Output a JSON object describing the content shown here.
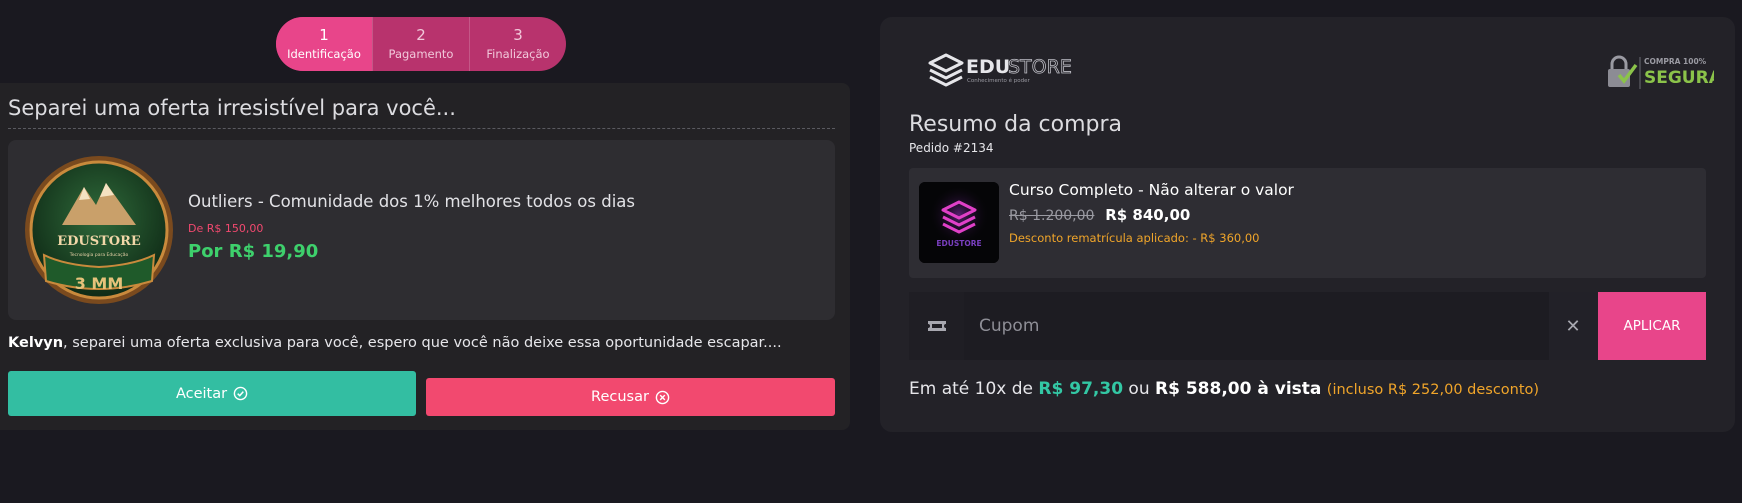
{
  "stepper": {
    "steps": [
      {
        "num": "1",
        "label": "Identificação"
      },
      {
        "num": "2",
        "label": "Pagamento"
      },
      {
        "num": "3",
        "label": "Finalização"
      }
    ],
    "active_index": 0
  },
  "offer": {
    "title": "Separei uma oferta irresistível para você...",
    "product_name": "Outliers - Comunidade dos 1% melhores todos os dias",
    "old_price": "De R$ 150,00",
    "new_price": "Por R$ 19,90",
    "badge_brand": "EDUSTORE",
    "badge_caption": "Tecnologia para Educação",
    "badge_label": "3 MM",
    "user_name": "Kelvyn",
    "message": ", separei uma oferta exclusiva para você, espero que você não deixe essa oportunidade escapar....",
    "accept_label": "Aceitar",
    "refuse_label": "Recusar"
  },
  "summary": {
    "logo_text_a": "EDU",
    "logo_text_b": "STORE",
    "logo_tagline": "Conhecimento é poder",
    "secure_line1": "COMPRA 100%",
    "secure_line2": "SEGURA",
    "title": "Resumo da compra",
    "order_number": "Pedido #2134",
    "product": {
      "name": "Curso Completo - Não alterar o valor",
      "old_price": "R$ 1.200,00",
      "new_price": "R$ 840,00",
      "discount": "Desconto rematrícula aplicado: - R$ 360,00",
      "thumb_text": "EDUSTORE"
    },
    "coupon": {
      "placeholder": "Cupom",
      "value": "",
      "clear_symbol": "✕",
      "apply_label": "APLICAR"
    },
    "installments": {
      "prefix": "Em até 10x de ",
      "installment_value": "R$ 97,30",
      "middle": " ou ",
      "cash_value": "R$ 588,00 à vista",
      "discount_note": "(incluso R$ 252,00 desconto)"
    }
  },
  "colors": {
    "background": "#1a1920",
    "accent_pink": "#e8458a",
    "accept_green": "#33bea2",
    "refuse_red": "#f2496f",
    "price_green": "#3ed06c",
    "warning_orange": "#f0a52a"
  }
}
